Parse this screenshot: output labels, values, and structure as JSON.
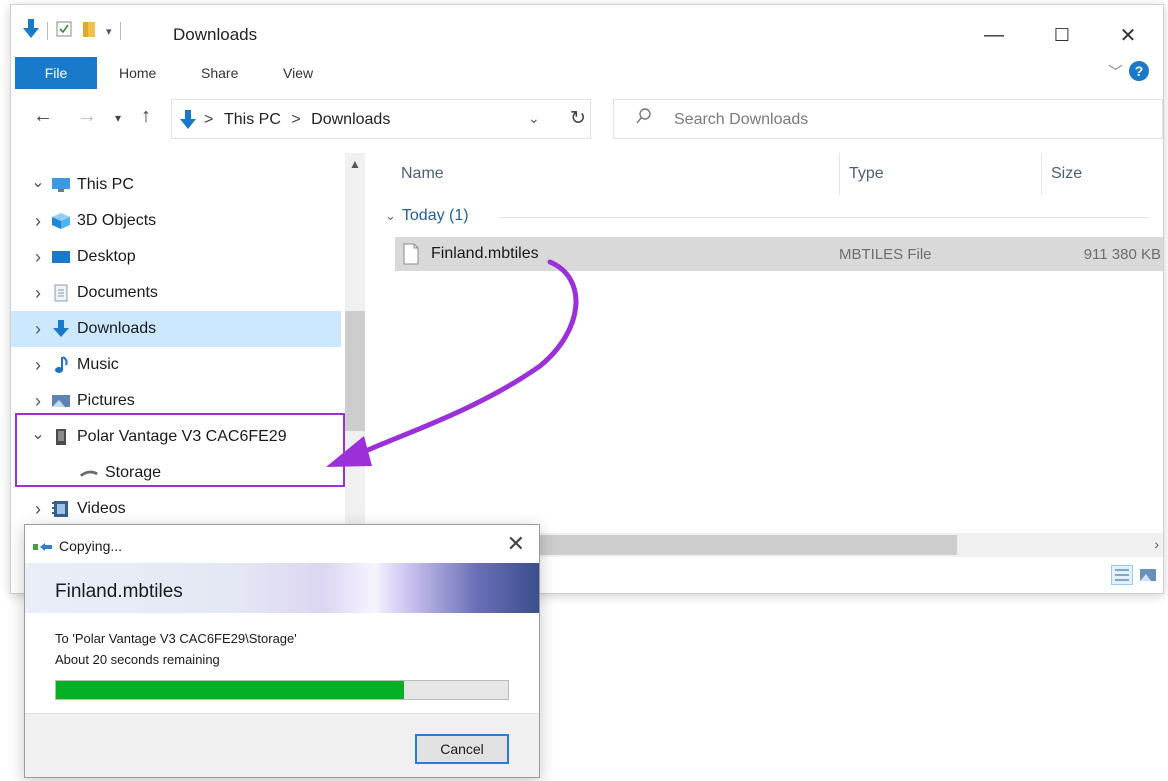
{
  "window": {
    "title": "Downloads",
    "controls": {
      "minimize": "—",
      "maximize": "☐",
      "close": "✕"
    }
  },
  "ribbon": {
    "tabs": [
      "File",
      "Home",
      "Share",
      "View"
    ],
    "help": "?"
  },
  "address": {
    "path_root": "This PC",
    "path_sep": ">",
    "path_current": "Downloads",
    "search_placeholder": "Search Downloads"
  },
  "nav": {
    "items": [
      {
        "label": "This PC",
        "arrow": "expanded",
        "icon": "computer-icon"
      },
      {
        "label": "3D Objects",
        "arrow": "collapsed",
        "icon": "3d-objects-icon"
      },
      {
        "label": "Desktop",
        "arrow": "collapsed",
        "icon": "desktop-icon"
      },
      {
        "label": "Documents",
        "arrow": "collapsed",
        "icon": "documents-icon"
      },
      {
        "label": "Downloads",
        "arrow": "collapsed",
        "icon": "download-arrow-icon",
        "selected": true
      },
      {
        "label": "Music",
        "arrow": "collapsed",
        "icon": "music-note-icon"
      },
      {
        "label": "Pictures",
        "arrow": "collapsed",
        "icon": "pictures-icon"
      },
      {
        "label": "Polar Vantage V3 CAC6FE29",
        "arrow": "expanded",
        "icon": "device-icon"
      },
      {
        "label": "Storage",
        "arrow": "none",
        "icon": "storage-drive-icon"
      },
      {
        "label": "Videos",
        "arrow": "collapsed",
        "icon": "videos-icon"
      }
    ]
  },
  "content": {
    "columns": {
      "name": "Name",
      "type": "Type",
      "size": "Size"
    },
    "group": {
      "label": "Today (1)"
    },
    "files": [
      {
        "name": "Finland.mbtiles",
        "type": "MBTILES File",
        "size": "911 380 KB"
      }
    ]
  },
  "copy_dialog": {
    "title": "Copying...",
    "file": "Finland.mbtiles",
    "destination": "To 'Polar Vantage V3 CAC6FE29\\Storage'",
    "remaining": "About 20 seconds remaining",
    "progress_fraction": 0.77,
    "cancel_label": "Cancel"
  },
  "colors": {
    "accent": "#1979ca",
    "highlight_annotation": "#9b30d9",
    "progress": "#06b025",
    "selection": "#cce8ff"
  }
}
